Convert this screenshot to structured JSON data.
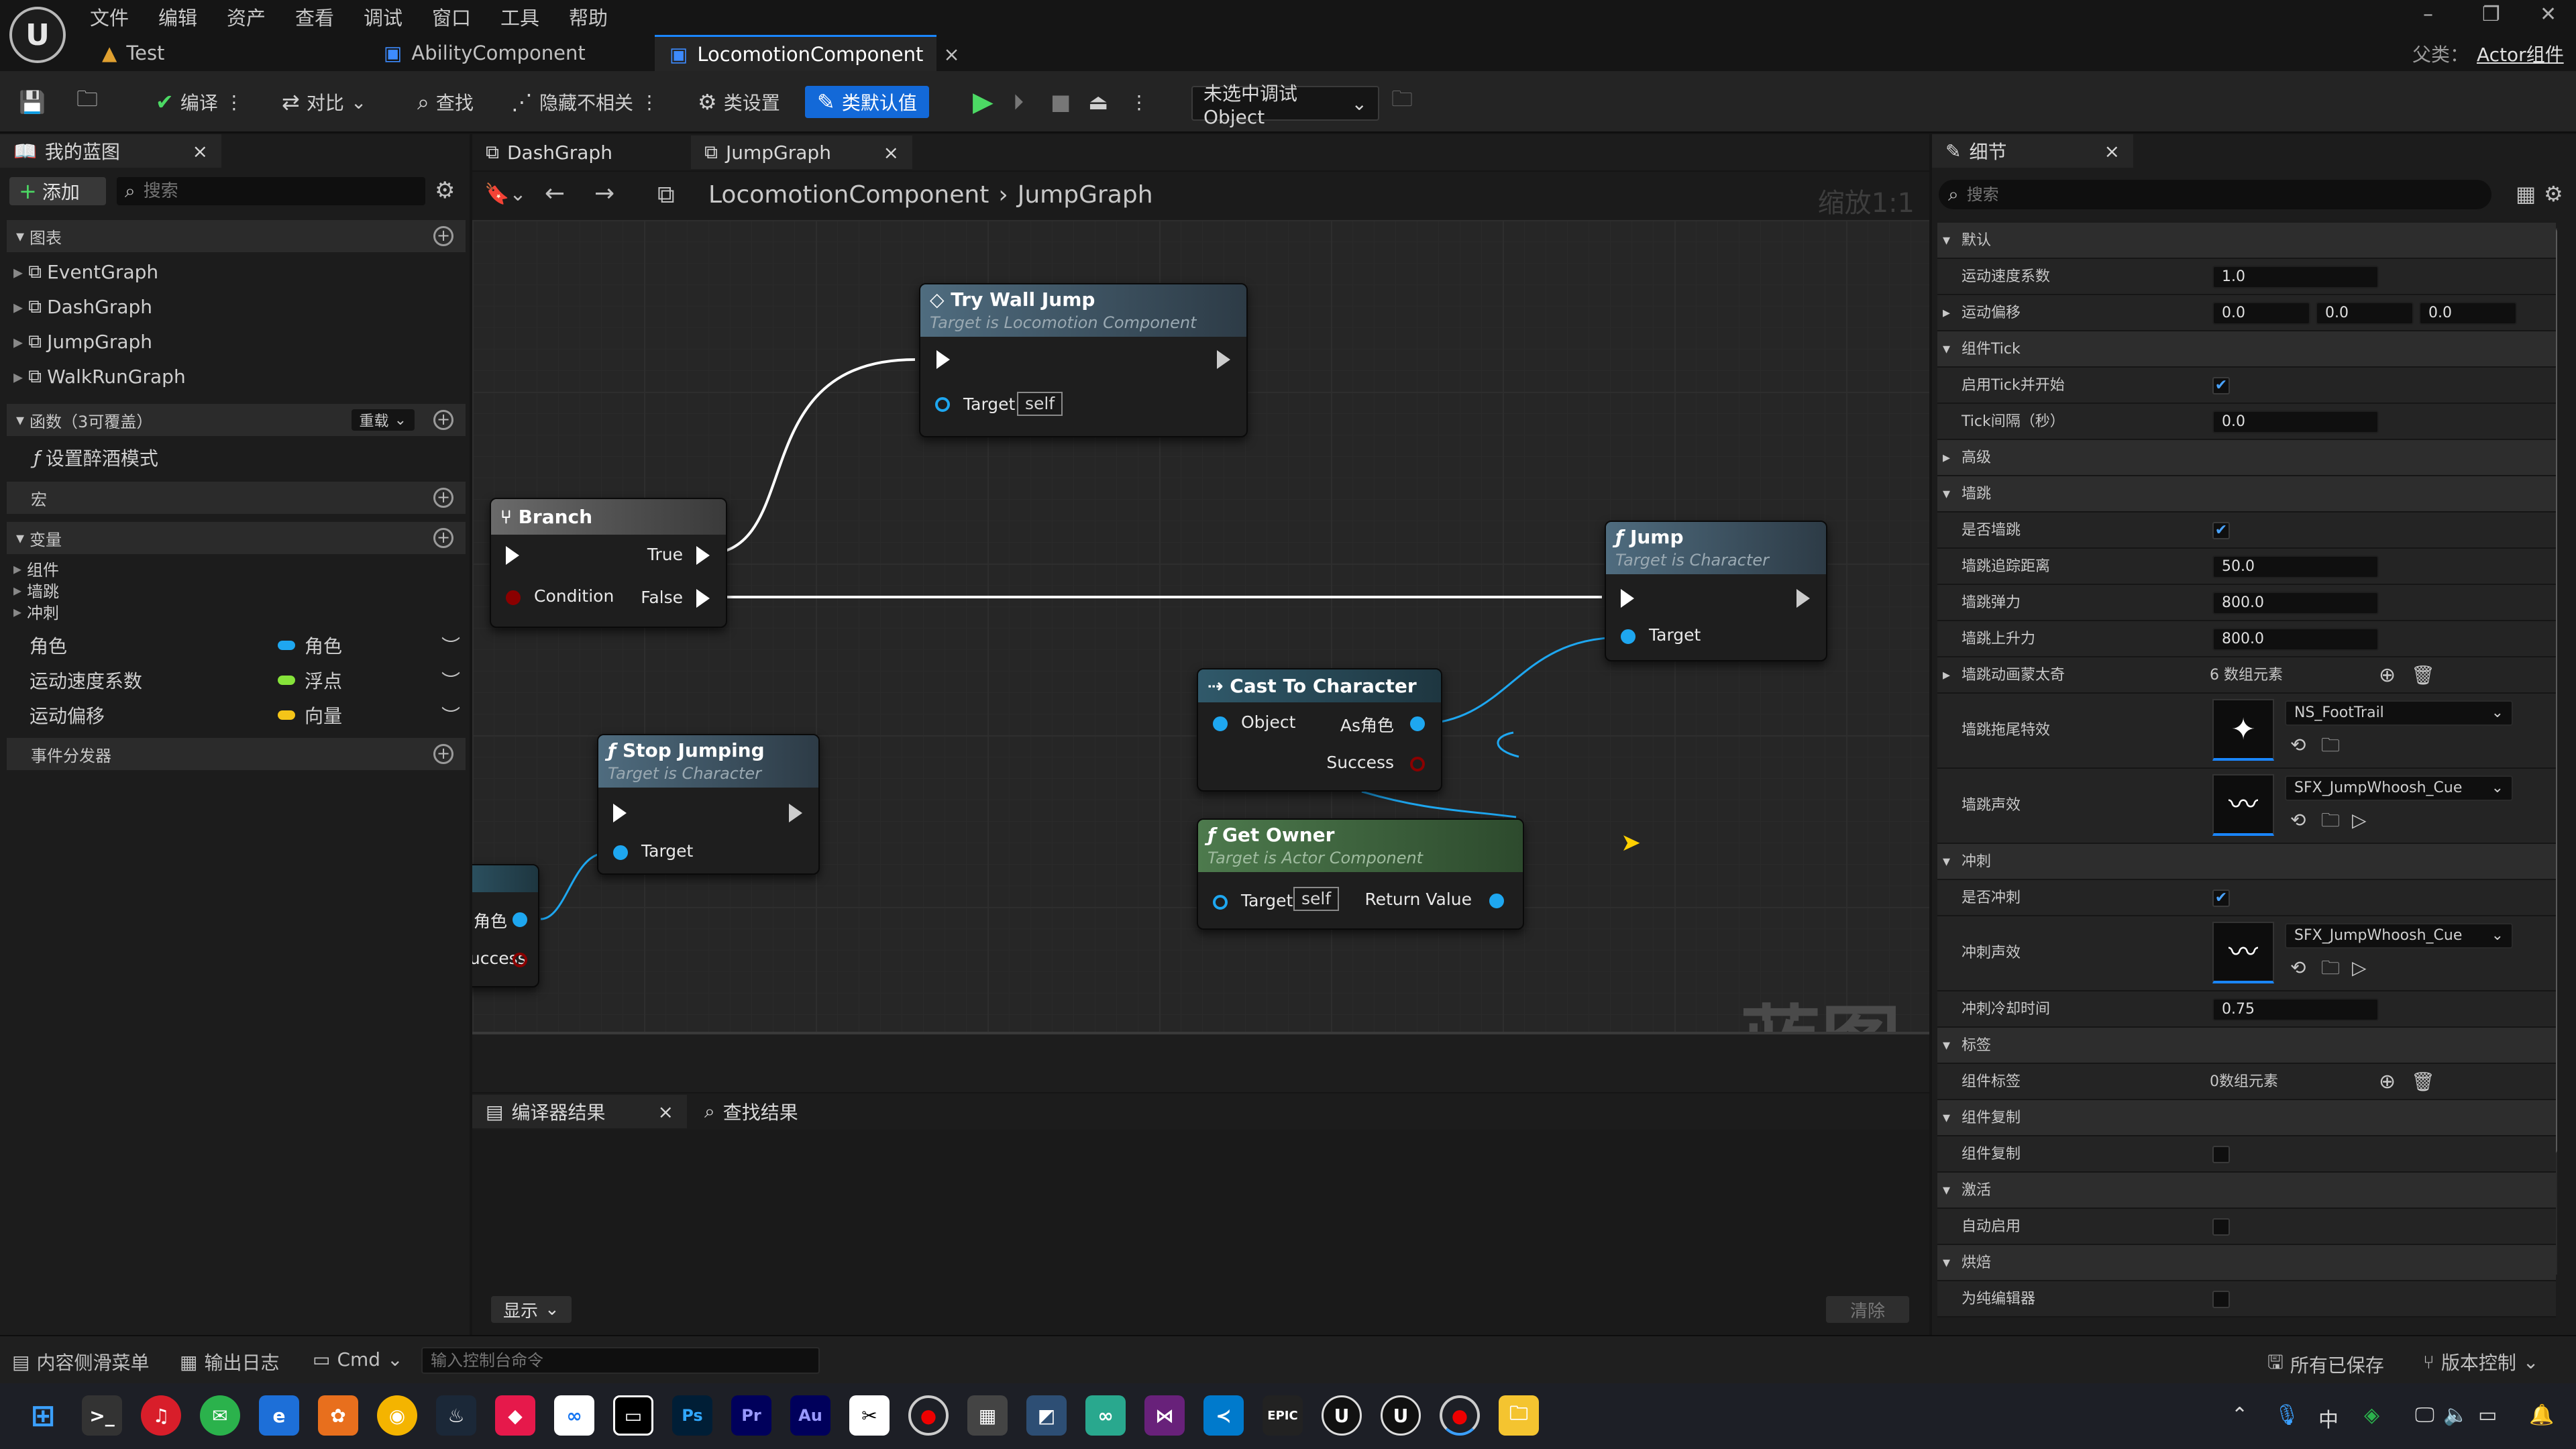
{
  "menu": [
    "文件",
    "编辑",
    "资产",
    "查看",
    "调试",
    "窗口",
    "工具",
    "帮助"
  ],
  "doc_tabs": [
    {
      "label": "Test",
      "active": false
    },
    {
      "label": "AbilityComponent",
      "active": false
    },
    {
      "label": "LocomotionComponent",
      "active": true
    }
  ],
  "parent_class": {
    "label": "父类：",
    "value": "Actor组件"
  },
  "toolbar": {
    "compile": "编译",
    "diff": "对比",
    "find": "查找",
    "hide_unrelated": "隐藏不相关",
    "class_settings": "类设置",
    "class_defaults": "类默认值",
    "debug_object": "未选中调试Object"
  },
  "my_blueprint": {
    "tab": "我的蓝图",
    "add": "添加",
    "search_placeholder": "搜索",
    "graphs_header": "图表",
    "graphs": [
      "EventGraph",
      "DashGraph",
      "JumpGraph",
      "WalkRunGraph"
    ],
    "functions_header": "函数（3可覆盖）",
    "override": "重载",
    "functions": [
      "设置醉酒模式"
    ],
    "macros_header": "宏",
    "variables_header": "变量",
    "var_categories": [
      "组件",
      "墙跳",
      "冲刺"
    ],
    "variables": [
      {
        "name": "角色",
        "type": "角色",
        "color": "#1ea7f0"
      },
      {
        "name": "运动速度系数",
        "type": "浮点",
        "color": "#86e33a"
      },
      {
        "name": "运动偏移",
        "type": "向量",
        "color": "#f5c518"
      }
    ],
    "dispatchers_header": "事件分发器"
  },
  "graph": {
    "tabs": [
      {
        "label": "DashGraph"
      },
      {
        "label": "JumpGraph"
      }
    ],
    "breadcrumb": [
      "LocomotionComponent",
      "JumpGraph"
    ],
    "zoom": "缩放1:1",
    "watermark": "蓝图",
    "nodes": {
      "try_wall_jump": {
        "title": "Try Wall Jump",
        "subtitle": "Target is Locomotion Component",
        "target": "Target",
        "self": "self"
      },
      "branch": {
        "title": "Branch",
        "true": "True",
        "false": "False",
        "condition": "Condition"
      },
      "jump": {
        "title": "Jump",
        "subtitle": "Target is Character",
        "target": "Target"
      },
      "cast": {
        "title": "Cast To Character",
        "object": "Object",
        "as": "As角色",
        "success": "Success"
      },
      "stop_jumping": {
        "title": "Stop Jumping",
        "subtitle": "Target is Character",
        "target": "Target"
      },
      "get_owner": {
        "title": "Get Owner",
        "subtitle": "Target is Actor Component",
        "target": "Target",
        "self": "self",
        "return": "Return Value"
      },
      "partial": {
        "pin1": "角色",
        "pin2": "Success"
      }
    }
  },
  "compile_panel": {
    "tab1": "编译器结果",
    "tab2": "查找结果",
    "show": "显示",
    "clear": "清除"
  },
  "details": {
    "tab": "细节",
    "search_placeholder": "搜索",
    "rows": [
      {
        "kind": "cat",
        "label": "默认"
      },
      {
        "kind": "input",
        "label": "运动速度系数",
        "value": "1.0"
      },
      {
        "kind": "vector",
        "label": "运动偏移",
        "values": [
          "0.0",
          "0.0",
          "0.0"
        ]
      },
      {
        "kind": "cat",
        "label": "组件Tick"
      },
      {
        "kind": "check",
        "label": "启用Tick并开始",
        "checked": true
      },
      {
        "kind": "input",
        "label": "Tick间隔（秒）",
        "value": "0.0"
      },
      {
        "kind": "cat",
        "label": "高级"
      },
      {
        "kind": "cat",
        "label": "墙跳"
      },
      {
        "kind": "check",
        "label": "是否墙跳",
        "checked": true
      },
      {
        "kind": "input",
        "label": "墙跳追踪距离",
        "value": "50.0"
      },
      {
        "kind": "input",
        "label": "墙跳弹力",
        "value": "800.0"
      },
      {
        "kind": "input",
        "label": "墙跳上升力",
        "value": "800.0"
      },
      {
        "kind": "array",
        "label": "墙跳动画蒙太奇",
        "value": "6 数组元素"
      }
    ],
    "wall_trail": {
      "label": "墙跳拖尾特效",
      "asset": "NS_FootTrail"
    },
    "wall_sound": {
      "label": "墙跳声效",
      "asset": "SFX_JumpWhoosh_Cue"
    },
    "rows2": [
      {
        "kind": "cat",
        "label": "冲刺"
      },
      {
        "kind": "check",
        "label": "是否冲刺",
        "checked": true
      }
    ],
    "dash_sound": {
      "label": "冲刺声效",
      "asset": "SFX_JumpWhoosh_Cue"
    },
    "rows3": [
      {
        "kind": "input",
        "label": "冲刺冷却时间",
        "value": "0.75"
      },
      {
        "kind": "cat",
        "label": "标签"
      },
      {
        "kind": "array",
        "label": "组件标签",
        "value": "0数组元素"
      },
      {
        "kind": "cat",
        "label": "组件复制"
      },
      {
        "kind": "check",
        "label": "组件复制",
        "checked": false
      },
      {
        "kind": "cat",
        "label": "激活"
      },
      {
        "kind": "check",
        "label": "自动启用",
        "checked": false
      },
      {
        "kind": "cat",
        "label": "烘焙"
      },
      {
        "kind": "check",
        "label": "为纯编辑器",
        "checked": false
      }
    ]
  },
  "statusbar": {
    "content_drawer": "内容侧滑菜单",
    "output_log": "输出日志",
    "cmd": "Cmd",
    "console_placeholder": "输入控制台命令",
    "all_saved": "所有已保存",
    "source_control": "版本控制"
  },
  "taskbar": {
    "ime": "中"
  }
}
